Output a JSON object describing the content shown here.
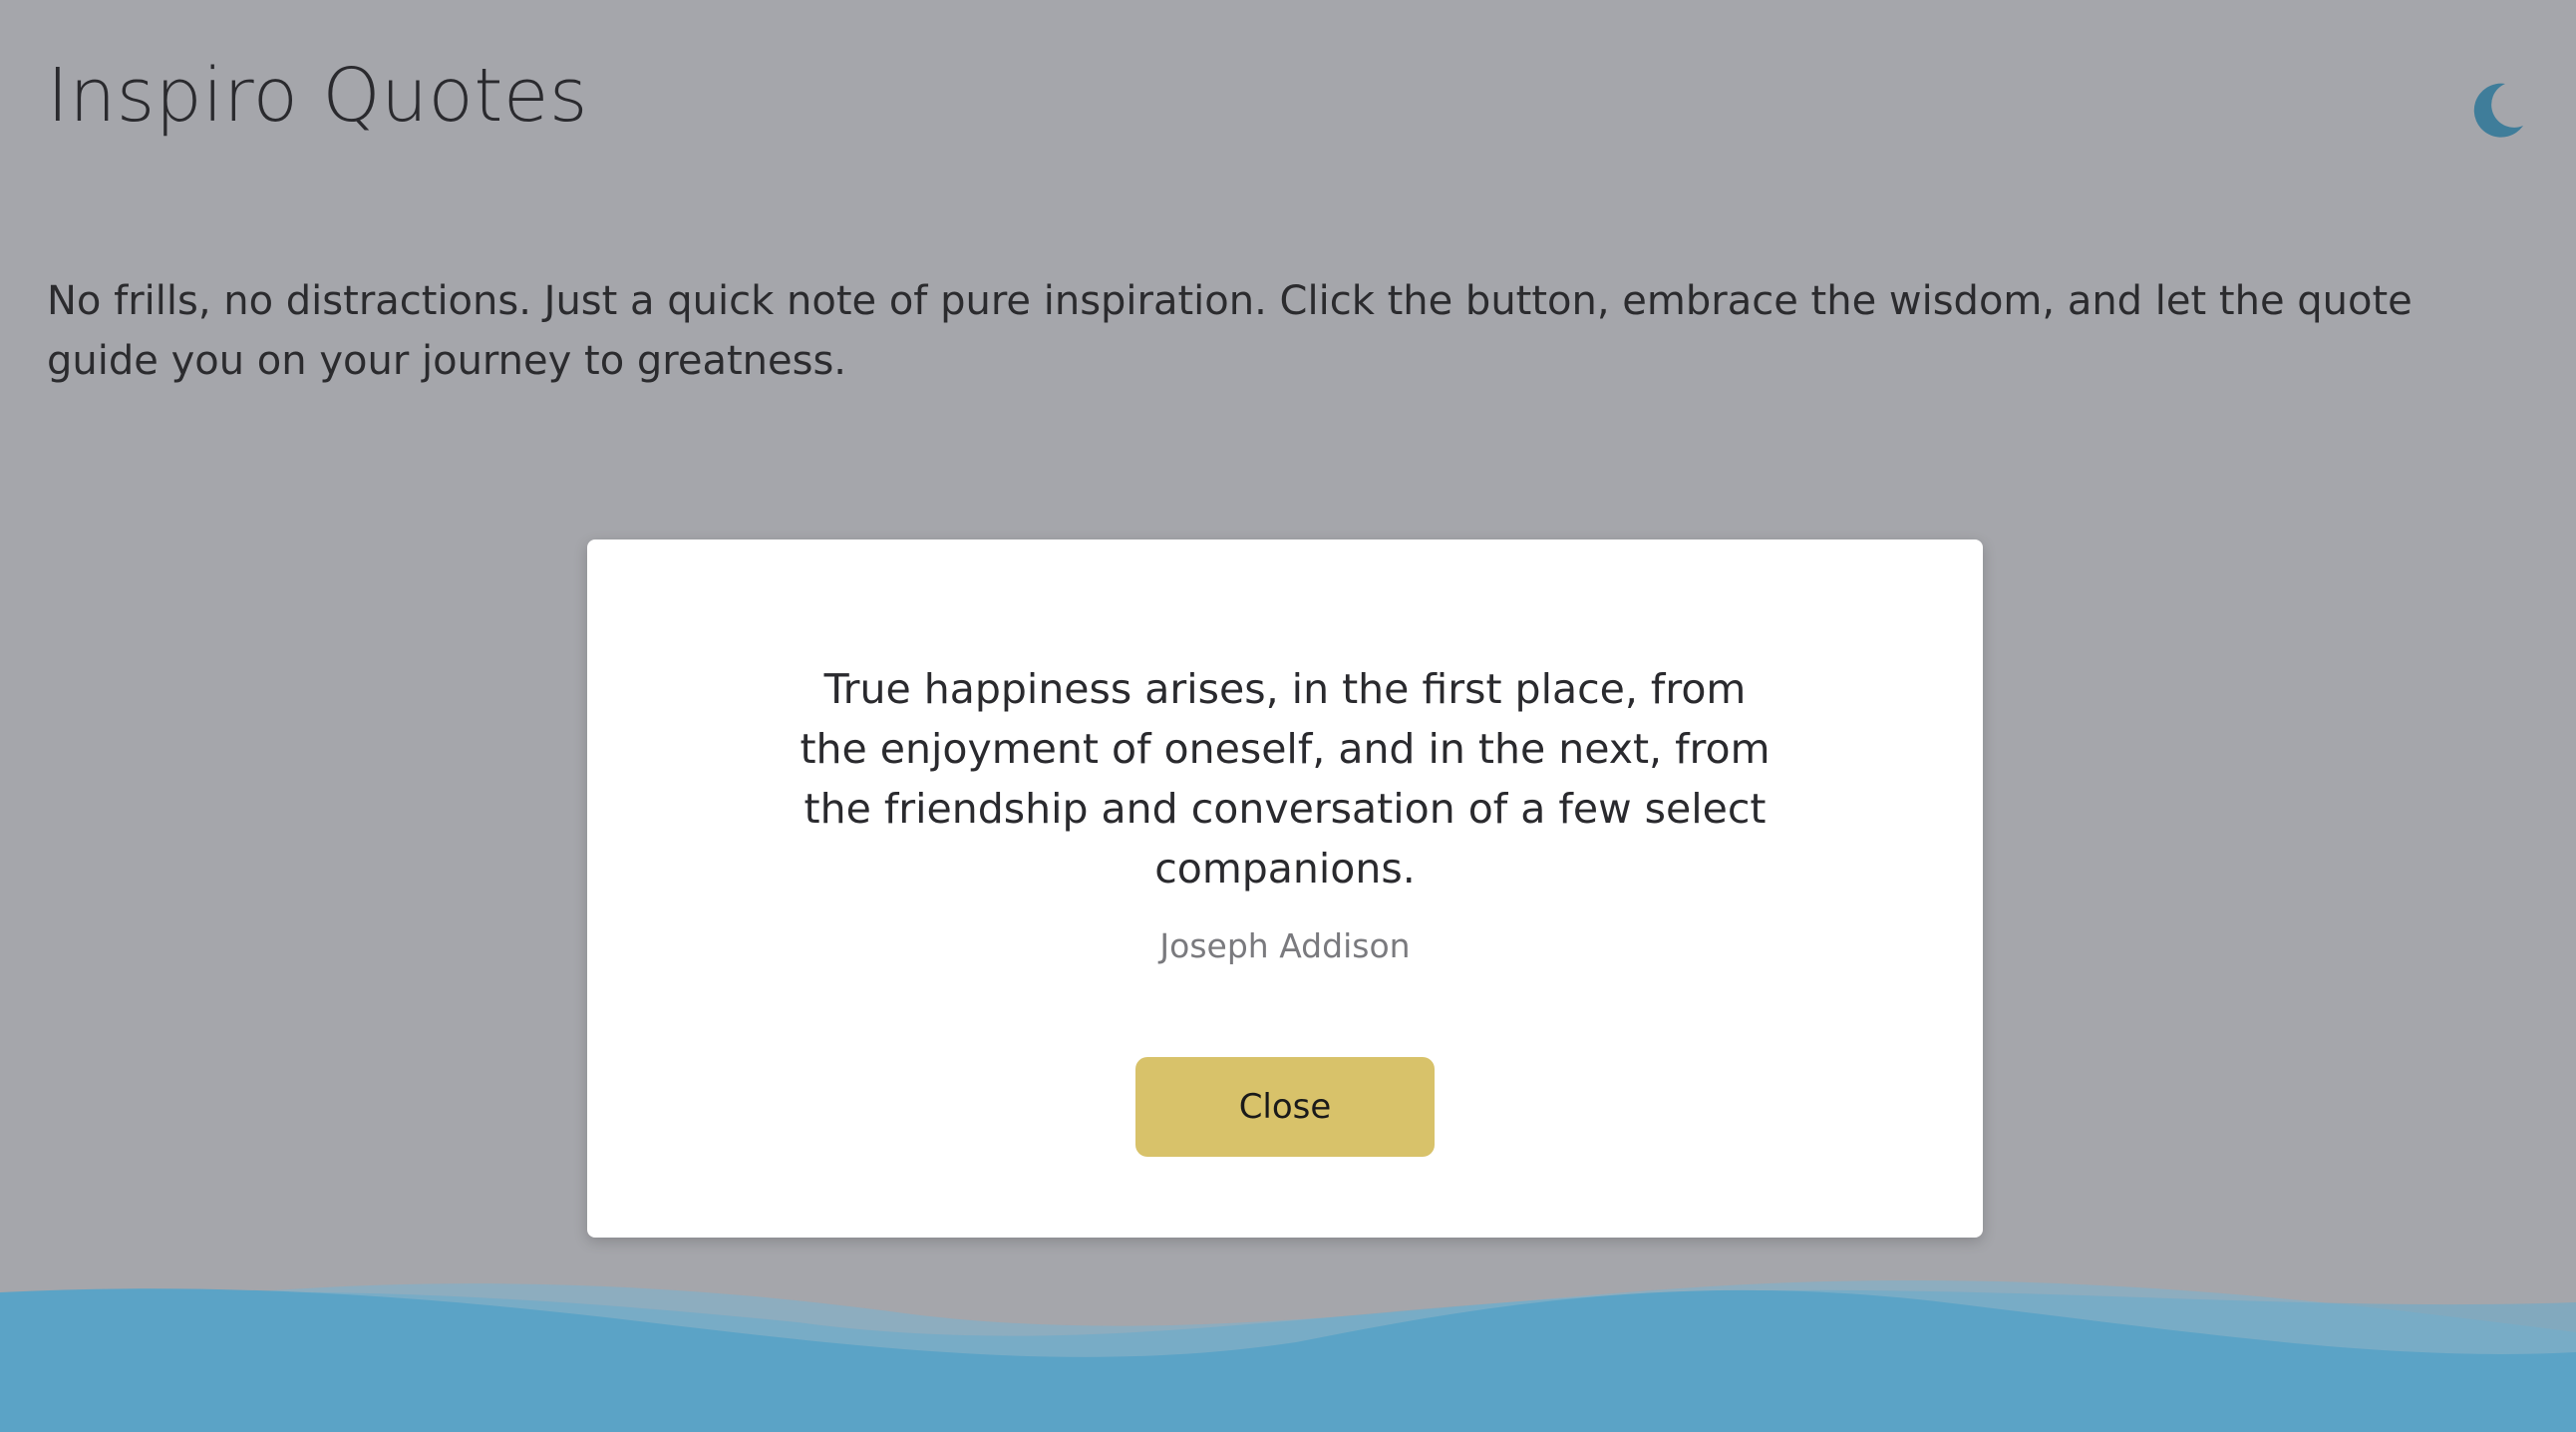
{
  "header": {
    "title": "Inspiro Quotes",
    "theme_toggle_icon": "moon-icon"
  },
  "intro": {
    "text": "No frills, no distractions. Just a quick note of pure inspiration. Click the button, embrace the wisdom, and let the quote guide you on your journey to greatness."
  },
  "modal": {
    "quote": "True happiness arises, in the first place, from the enjoyment of oneself, and in the next, from the friendship and conversation of a few select companions.",
    "author": "Joseph Addison",
    "close_label": "Close"
  },
  "colors": {
    "background": "#a5a6ab",
    "modal_background": "#ffffff",
    "button_background": "#d8c26a",
    "moon_icon": "#3f7d9a",
    "wave_primary": "#5ba3c6",
    "wave_secondary": "#7ab3cf"
  }
}
